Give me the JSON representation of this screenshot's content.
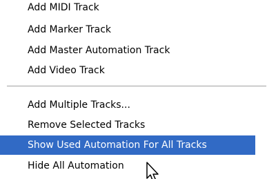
{
  "menu": {
    "items": [
      {
        "label": "Add MIDI Track"
      },
      {
        "label": "Add Marker Track"
      },
      {
        "label": "Add Master Automation Track"
      },
      {
        "label": "Add Video Track"
      },
      {
        "label": "Add Multiple Tracks..."
      },
      {
        "label": "Remove Selected Tracks"
      },
      {
        "label": "Show Used Automation For All Tracks",
        "highlighted": true
      },
      {
        "label": "Hide All Automation"
      }
    ]
  },
  "colors": {
    "highlight": "#316ac5",
    "highlight_text": "#ffffff",
    "text": "#000000",
    "separator": "#a0a0a0"
  },
  "cursor": "arrow-pointer-icon"
}
